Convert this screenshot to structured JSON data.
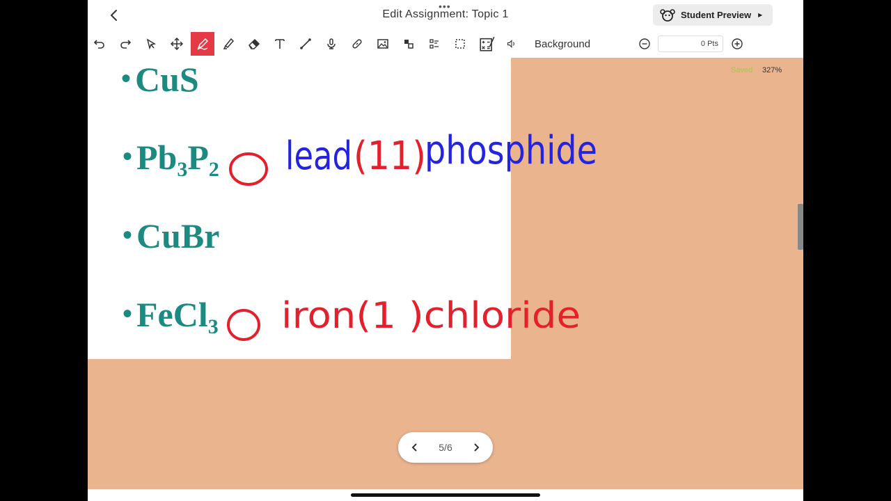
{
  "header": {
    "title": "Edit Assignment: Topic 1",
    "student_preview_label": "Student Preview"
  },
  "toolbar": {
    "tools": [
      {
        "icon": "undo-icon"
      },
      {
        "icon": "redo-icon"
      },
      {
        "icon": "select-icon"
      },
      {
        "icon": "move-icon"
      },
      {
        "icon": "pen-icon",
        "active": true
      },
      {
        "icon": "highlighter-icon"
      },
      {
        "icon": "eraser-icon"
      },
      {
        "icon": "text-icon"
      },
      {
        "icon": "line-icon"
      },
      {
        "icon": "microphone-icon"
      },
      {
        "icon": "link-icon"
      },
      {
        "icon": "image-icon"
      },
      {
        "icon": "shapes-icon"
      },
      {
        "icon": "list-icon"
      },
      {
        "icon": "marquee-icon"
      },
      {
        "icon": "calculator-icon"
      },
      {
        "icon": "speaker-icon"
      }
    ],
    "background_label": "Background",
    "points_value": "0 Pts",
    "active_color": "#e63946"
  },
  "canvas": {
    "zoom": "327%",
    "saved_label": "Saved",
    "background_color": "#e9b48e",
    "formulas": [
      {
        "main": "CuS",
        "sub": ""
      },
      {
        "main_pre": "Pb",
        "sub1": "3",
        "mid": "P",
        "sub": "2"
      },
      {
        "main": "CuBr",
        "sub": ""
      },
      {
        "main_pre": "FeCl",
        "sub": "3"
      }
    ],
    "annotations": {
      "line2_blue_a": "lead",
      "line2_red": "(11)",
      "line2_blue_b": "phosphide",
      "line4_red": "iron(1 )chloride"
    }
  },
  "pager": {
    "label": "5/6"
  }
}
